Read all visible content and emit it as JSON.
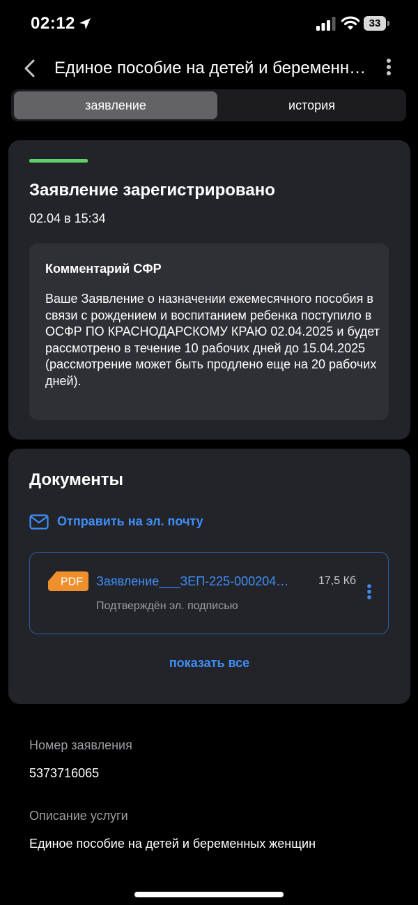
{
  "status_bar": {
    "time": "02:12",
    "battery": "33"
  },
  "header": {
    "title": "Единое пособие на детей и беременных женщин"
  },
  "tabs": [
    {
      "label": "заявление",
      "active": true
    },
    {
      "label": "история",
      "active": false
    }
  ],
  "status_card": {
    "title": "Заявление зарегистрировано",
    "date": "02.04 в 15:34",
    "comment_title": "Комментарий СФР",
    "comment_text": "Ваше Заявление о назначении ежемесячного пособия в связи с рождением и воспитанием ребенка поступило в ОСФР ПО КРАСНОДАРСКОМУ КРАЮ 02.04.2025 и будет рассмотрено в течение 10 рабочих дней до 15.04.2025 (рассмотрение может быть продлено еще на 20 рабочих дней)."
  },
  "documents": {
    "title": "Документы",
    "email_label": "Отправить на эл. почту",
    "items": [
      {
        "badge": "PDF",
        "name": "Заявление___ЗЕП-225-000204…",
        "size": "17,5 Кб",
        "subtitle": "Подтверждён эл. подписью"
      }
    ],
    "show_all": "показать все"
  },
  "info": {
    "number_label": "Номер заявления",
    "number_value": "5373716065",
    "service_label": "Описание услуги",
    "service_value": "Единое пособие на детей и беременных женщин"
  },
  "colors": {
    "background": "#000000",
    "card": "#232429",
    "accent": "#3e8ef7",
    "status_green": "#5fd068",
    "pdf_orange": "#f0902c"
  }
}
